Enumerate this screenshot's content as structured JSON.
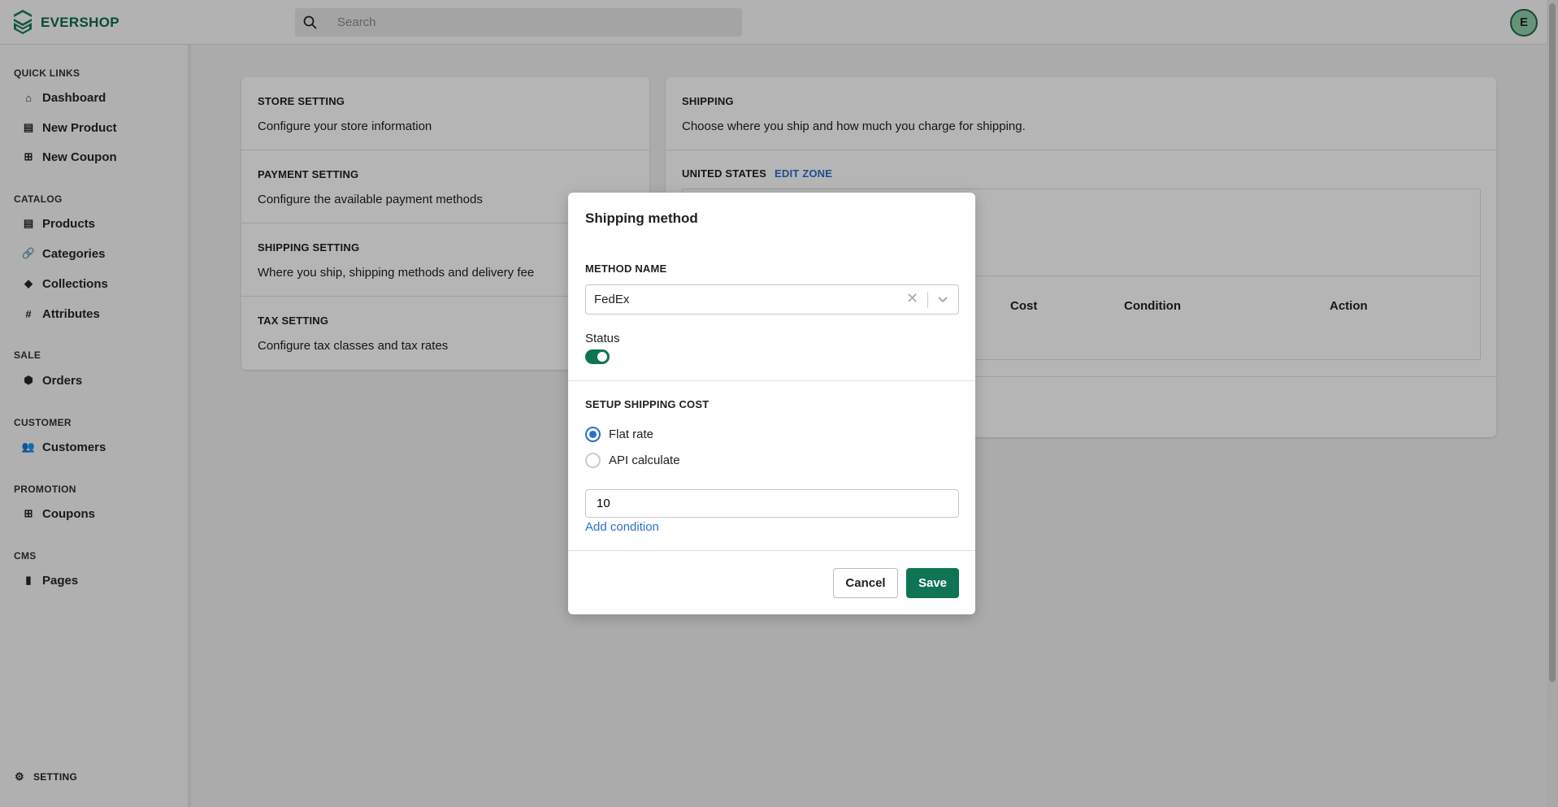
{
  "header": {
    "brand": "EVERSHOP",
    "search_placeholder": "Search",
    "avatar_initial": "E"
  },
  "sidebar": {
    "sections": [
      {
        "title": "QUICK LINKS",
        "items": [
          {
            "label": "Dashboard",
            "icon": "home-icon"
          },
          {
            "label": "New Product",
            "icon": "archive-icon"
          },
          {
            "label": "New Coupon",
            "icon": "gift-icon"
          }
        ]
      },
      {
        "title": "CATALOG",
        "items": [
          {
            "label": "Products",
            "icon": "archive-icon"
          },
          {
            "label": "Categories",
            "icon": "link-icon"
          },
          {
            "label": "Collections",
            "icon": "tag-icon"
          },
          {
            "label": "Attributes",
            "icon": "hash-icon"
          }
        ]
      },
      {
        "title": "SALE",
        "items": [
          {
            "label": "Orders",
            "icon": "cube-icon"
          }
        ]
      },
      {
        "title": "CUSTOMER",
        "items": [
          {
            "label": "Customers",
            "icon": "users-icon"
          }
        ]
      },
      {
        "title": "PROMOTION",
        "items": [
          {
            "label": "Coupons",
            "icon": "gift-icon"
          }
        ]
      },
      {
        "title": "CMS",
        "items": [
          {
            "label": "Pages",
            "icon": "document-icon"
          }
        ]
      }
    ],
    "setting": "SETTING"
  },
  "settings": [
    {
      "title": "STORE SETTING",
      "desc": "Configure your store information"
    },
    {
      "title": "PAYMENT SETTING",
      "desc": "Configure the available payment methods"
    },
    {
      "title": "SHIPPING SETTING",
      "desc": "Where you ship, shipping methods and delivery fee"
    },
    {
      "title": "TAX SETTING",
      "desc": "Configure tax classes and tax rates"
    }
  ],
  "shipping": {
    "title": "SHIPPING",
    "desc": "Choose where you ship and how much you charge for shipping.",
    "zone": "UNITED STATES",
    "edit_zone": "EDIT ZONE",
    "columns": [
      "Cost",
      "Condition",
      "Action"
    ]
  },
  "modal": {
    "title": "Shipping method",
    "method_label": "METHOD NAME",
    "method_value": "FedEx",
    "status_label": "Status",
    "status_on": true,
    "cost_label": "SETUP SHIPPING COST",
    "options": [
      "Flat rate",
      "API calculate"
    ],
    "selected": "Flat rate",
    "cost_value": "10",
    "add_condition": "Add condition",
    "cancel": "Cancel",
    "save": "Save"
  },
  "colors": {
    "brand": "#0c6b4e",
    "link": "#2c6ecb",
    "primary_button": "#0f7454"
  }
}
